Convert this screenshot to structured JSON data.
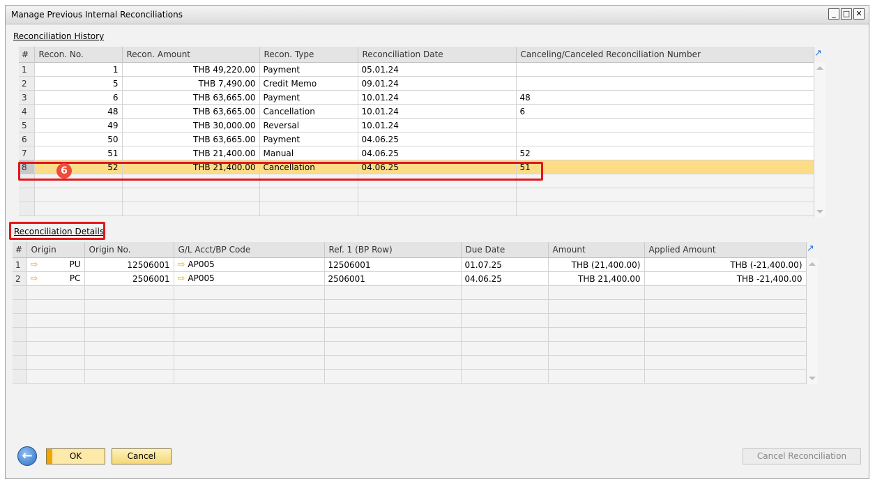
{
  "window": {
    "title": "Manage Previous Internal Reconciliations"
  },
  "history": {
    "section_title": "Reconciliation History",
    "columns": [
      "#",
      "Recon. No.",
      "Recon. Amount",
      "Recon. Type",
      "Reconciliation Date",
      "Canceling/Canceled Reconciliation Number"
    ],
    "rows": [
      {
        "idx": "1",
        "no": "1",
        "amount": "THB 49,220.00",
        "type": "Payment",
        "date": "05.01.24",
        "cancel": ""
      },
      {
        "idx": "2",
        "no": "5",
        "amount": "THB 7,490.00",
        "type": "Credit Memo",
        "date": "09.01.24",
        "cancel": ""
      },
      {
        "idx": "3",
        "no": "6",
        "amount": "THB 63,665.00",
        "type": "Payment",
        "date": "10.01.24",
        "cancel": "48"
      },
      {
        "idx": "4",
        "no": "48",
        "amount": "THB 63,665.00",
        "type": "Cancellation",
        "date": "10.01.24",
        "cancel": "6"
      },
      {
        "idx": "5",
        "no": "49",
        "amount": "THB 30,000.00",
        "type": "Reversal",
        "date": "10.01.24",
        "cancel": ""
      },
      {
        "idx": "6",
        "no": "50",
        "amount": "THB 63,665.00",
        "type": "Payment",
        "date": "04.06.25",
        "cancel": ""
      },
      {
        "idx": "7",
        "no": "51",
        "amount": "THB 21,400.00",
        "type": "Manual",
        "date": "04.06.25",
        "cancel": "52"
      },
      {
        "idx": "8",
        "no": "52",
        "amount": "THB 21,400.00",
        "type": "Cancellation",
        "date": "04.06.25",
        "cancel": "51"
      }
    ]
  },
  "step_badge": "6",
  "details": {
    "section_title": "Reconciliation Details",
    "columns": [
      "#",
      "Origin",
      "Origin No.",
      "G/L Acct/BP Code",
      "Ref. 1 (BP Row)",
      "Due Date",
      "Amount",
      "Applied Amount"
    ],
    "rows": [
      {
        "idx": "1",
        "origin": "PU",
        "origin_no": "12506001",
        "code": "AP005",
        "ref": "12506001",
        "due": "01.07.25",
        "amount": "THB (21,400.00)",
        "applied": "THB (-21,400.00)"
      },
      {
        "idx": "2",
        "origin": "PC",
        "origin_no": "2506001",
        "code": "AP005",
        "ref": "2506001",
        "due": "04.06.25",
        "amount": "THB 21,400.00",
        "applied": "THB -21,400.00"
      }
    ]
  },
  "buttons": {
    "ok": "OK",
    "cancel": "Cancel",
    "cancel_recon": "Cancel Reconciliation"
  },
  "colors": {
    "selected_row": "#fddc87",
    "highlight": "#e3161b",
    "badge": "#ef4c3a",
    "button": "#f5d874"
  }
}
